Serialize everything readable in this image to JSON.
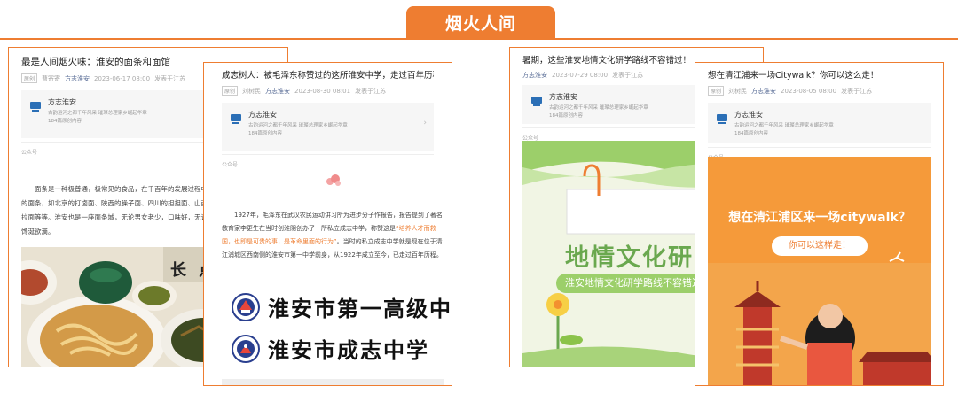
{
  "header": {
    "title": "烟火人间"
  },
  "profile_common": {
    "name": "方志淮安",
    "desc": "古韵运河之都千年风采 璀璨总理家乡崛起华章",
    "count": "184篇原创内容",
    "gzh": "公众号"
  },
  "card1": {
    "title": "最是人间烟火味：淮安的面条和面馆",
    "tag": "原创",
    "author": "曹寄寄",
    "account": "方志淮安",
    "date": "2023-06-17 08:00",
    "location": "发表于江苏",
    "paragraph": "面条是一种极普通，极常见的食品，在千百年的发展过程中，形成了各具地域特色的面条，如北京的打卤面、陕西的臊子面、四川的担担面、山西的刀削面、甘肃的兰州拉面等等。淮安也是一座面条城，无论男女老少，口味好，无论是色、香、味都能让人馋涎欲滴。",
    "sign_text": "长 点"
  },
  "card2": {
    "title": "成志树人：被毛泽东称赞过的这所淮安中学，走过百年历程",
    "tag": "原创",
    "author": "刘树民",
    "account": "方志淮安",
    "date": "2023-08-30 08:01",
    "location": "发表于江苏",
    "paragraph_a": "1927年，毛泽东在武汉农民运动讲习所为进步分子作报告，报告提到了著名教育家李更生在当时创淮阴创办了一所私立成志中学，称赞这是",
    "paragraph_hl": "“培养人才而救国，也即是可贵的事，是革命里面的行为”",
    "paragraph_b": "。当时的私立成志中学就是现在位于清江浦城区西南侧的淮安市第一中学前身，从1922年成立至今，已走过百年历程。",
    "school1": "淮安市第一高级中学",
    "school2": "淮安市成志中学"
  },
  "card3": {
    "title": "暑期，这些淮安地情文化研学路线不容错过！",
    "account": "方志淮安",
    "date": "2023-07-29 08:00",
    "location": "发表于江苏",
    "poster_title": "地情文化研学",
    "poster_sub": "淮安地情文化研学路线不容错过"
  },
  "card4": {
    "title": "想在清江浦来一场Citywalk？你可以这么走！",
    "tag": "原创",
    "author": "刘树民",
    "account": "方志淮安",
    "date": "2023-08-05 08:00",
    "location": "发表于江苏",
    "poster_title": "想在清江浦区来一场citywalk？",
    "poster_sub": "你可以这样走！"
  },
  "colors": {
    "accent": "#ee7d31",
    "green": "#7ab648",
    "poster_orange": "#f3a54b"
  },
  "icons": [
    "chevron-right-icon",
    "profile-logo-icon",
    "paperclip-icon",
    "flower-icon",
    "bird-icon",
    "school-emblem-icon"
  ]
}
